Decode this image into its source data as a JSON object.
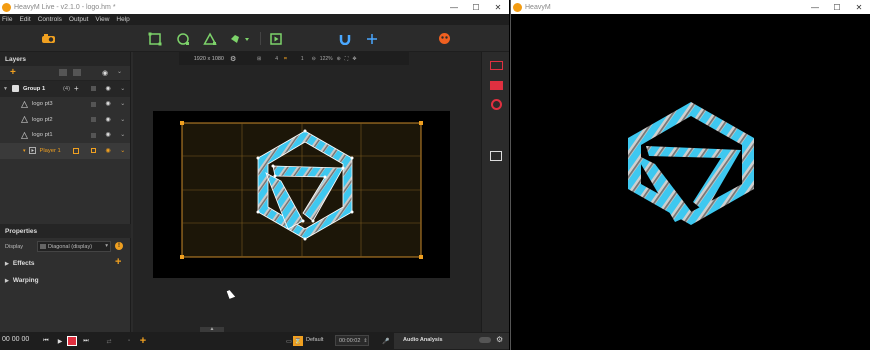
{
  "main_window": {
    "title": "HeavyM Live - v2.1.0 - logo.hm *",
    "controls": [
      "—",
      "☐",
      "✕"
    ]
  },
  "menu": [
    "File",
    "Edit",
    "Controls",
    "Output",
    "View",
    "Help"
  ],
  "canvas": {
    "resolution": "1920 x 1080",
    "zoom": "122%",
    "grid_count": "4",
    "snap_count": "1"
  },
  "layers_panel": {
    "title": "Layers",
    "items": [
      {
        "name": "Group 1",
        "count": "(4)"
      },
      {
        "name": "logo pt3"
      },
      {
        "name": "logo pt2"
      },
      {
        "name": "logo pt1"
      },
      {
        "name": "Player 1"
      }
    ]
  },
  "properties_panel": {
    "title": "Properties",
    "display_label": "Display",
    "display_value": "Diagonal (display)",
    "effects_label": "Effects",
    "warping_label": "Warping"
  },
  "bottom_bar": {
    "timecode": "00 00 00",
    "default_label": "Default",
    "time_value": "00:00:02",
    "audio_label": "Audio Analysis"
  },
  "output_window": {
    "title": "HeavyM",
    "controls": [
      "—",
      "☐",
      "✕"
    ]
  },
  "colors": {
    "accent": "#f0a020",
    "toolbar_green": "#7dd36a",
    "tool_blue": "#4aa8ff",
    "logo_cyan": "#3ec8f0",
    "red": "#e03040"
  }
}
